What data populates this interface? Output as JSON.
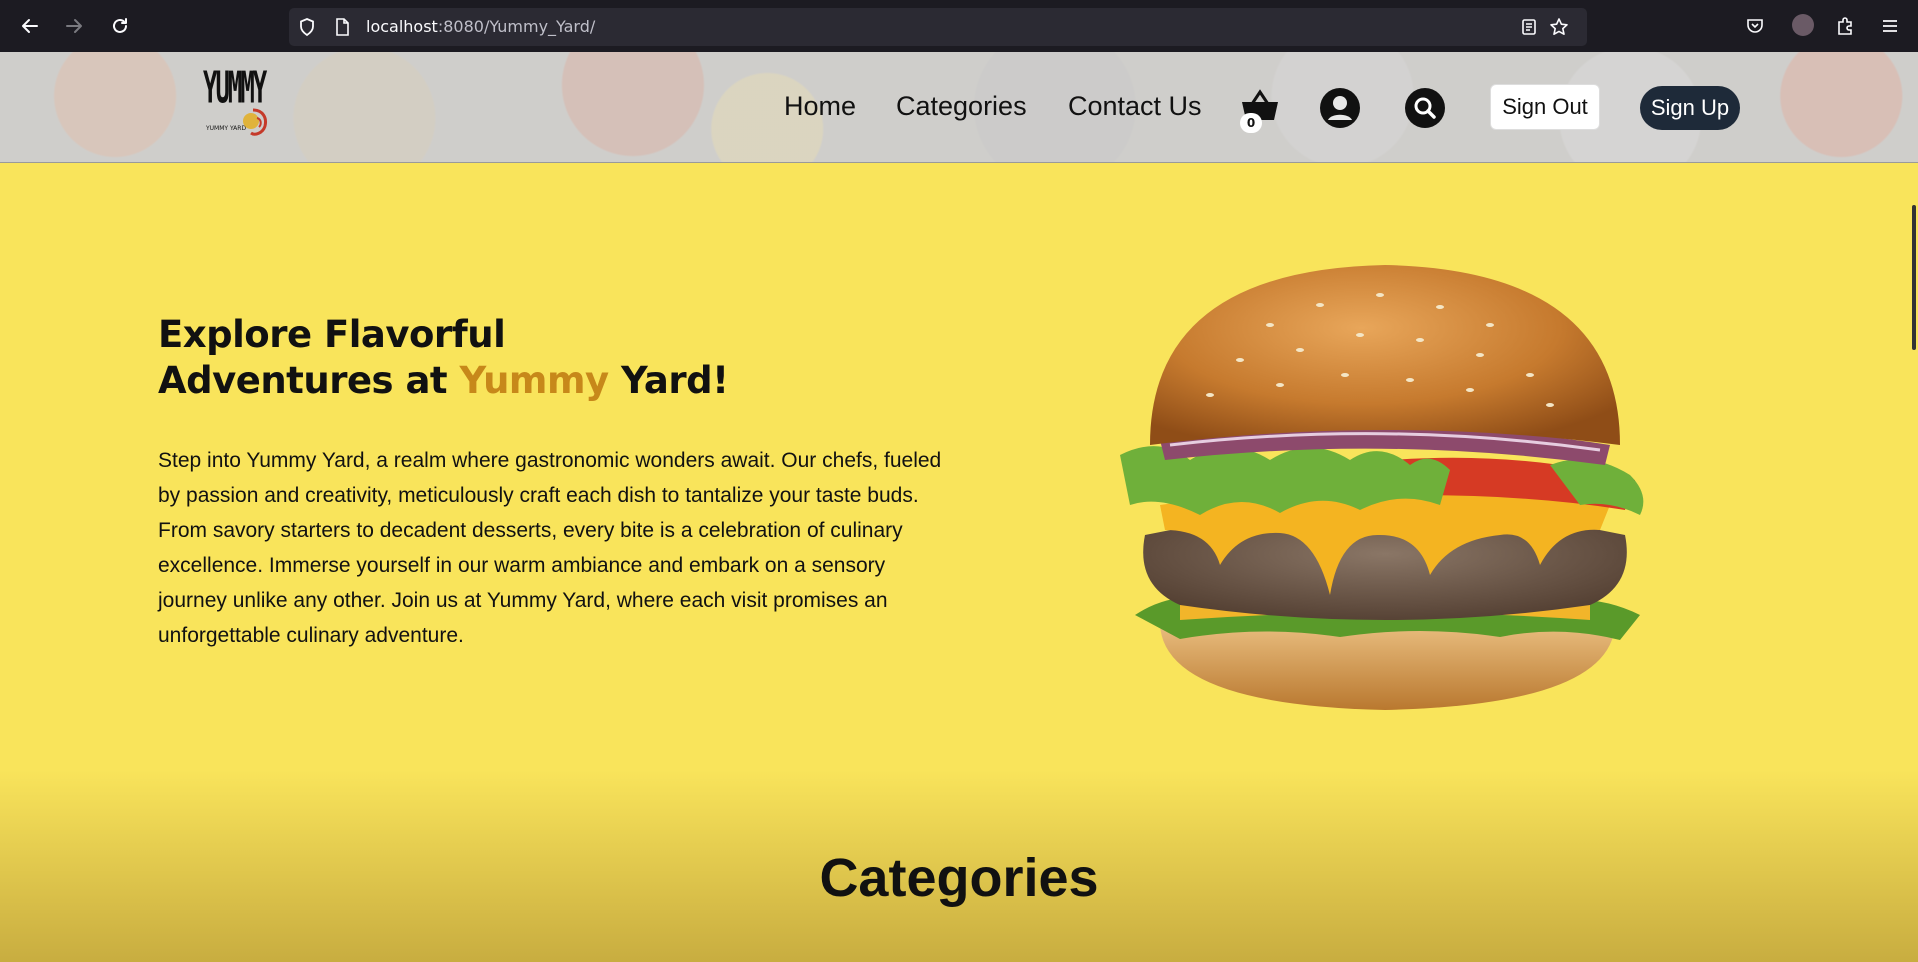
{
  "browser": {
    "url_host": "localhost",
    "url_rest": ":8080/Yummy_Yard/"
  },
  "header": {
    "logo_word": "YUMMY",
    "logo_sub": "YUMMY YARD",
    "menu": {
      "home": "Home",
      "categories": "Categories",
      "contact": "Contact Us"
    },
    "cart_count": "0",
    "sign_out": "Sign Out",
    "sign_up": "Sign Up"
  },
  "hero": {
    "title_line1": "Explore Flavorful",
    "title_line2_pre": "Adventures at ",
    "title_accent": "Yummy",
    "title_line2_post": " Yard!",
    "body": "Step into Yummy Yard, a realm where gastronomic wonders await. Our chefs, fueled by passion and creativity, meticulously craft each dish to tantalize your taste buds. From savory starters to decadent desserts, every bite is a celebration of culinary excellence. Immerse yourself in our warm ambiance and embark on a sensory journey unlike any other. Join us at Yummy Yard, where each visit promises an unforgettable culinary adventure."
  },
  "categories": {
    "title": "Categories"
  },
  "colors": {
    "page_bg": "#f9e45b",
    "accent": "#c7881a",
    "signup_bg": "#1e2a39"
  }
}
